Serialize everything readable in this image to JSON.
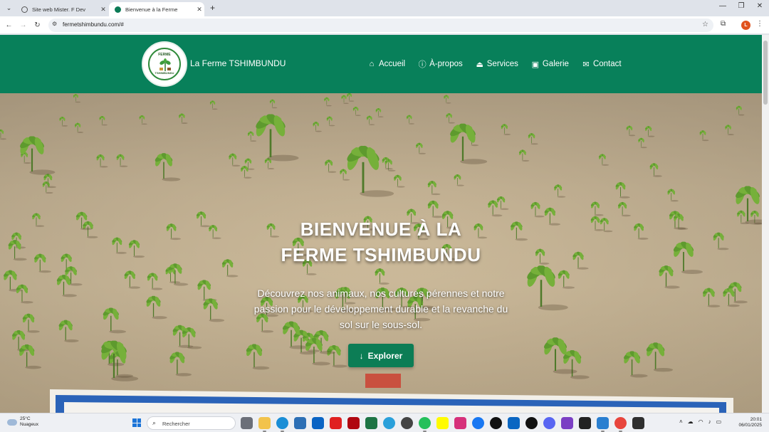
{
  "browser": {
    "tabs": [
      {
        "label": "Site web Mister. F Dev",
        "active": false
      },
      {
        "label": "Bienvenue à la Ferme",
        "active": true
      }
    ],
    "new_tab_glyph": "+",
    "url": "fermetshimbundu.com/#",
    "window_controls": {
      "minimize": "—",
      "restore": "❐",
      "close": "✕"
    },
    "profile_initial": "L"
  },
  "site": {
    "logo_top_text": "FERME",
    "logo_bottom_text": "TSHIMBUNDU",
    "brand": "La Ferme TSHIMBUNDU",
    "nav": [
      {
        "icon": "home-icon",
        "label": "Accueil"
      },
      {
        "icon": "info-icon",
        "label": "À-propos"
      },
      {
        "icon": "hand-holding-icon",
        "label": "Services"
      },
      {
        "icon": "images-icon",
        "label": "Galerie"
      },
      {
        "icon": "envelope-icon",
        "label": "Contact"
      }
    ],
    "hero": {
      "title_line1": "BIENVENUE À LA",
      "title_line2": "FERME TSHIMBUNDU",
      "subtitle": "Découvrez nos animaux, nos cultures pérennes et notre passion pour le développement durable et la revanche du sol sur le sous-sol.",
      "button_label": "Explorer"
    },
    "colors": {
      "primary": "#08805a",
      "button": "#0c7d55"
    }
  },
  "taskbar": {
    "weather_temp": "25°C",
    "weather_desc": "Nuageux",
    "search_placeholder": "Rechercher",
    "time": "20:01",
    "date": "06/01/2025"
  }
}
